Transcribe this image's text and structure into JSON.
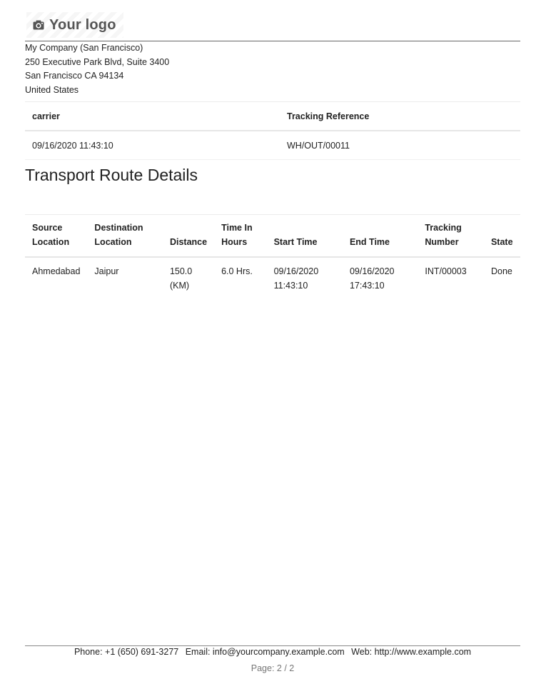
{
  "logo": {
    "text": "Your logo",
    "icon": "camera-icon"
  },
  "company": {
    "name": "My Company (San Francisco)",
    "street": "250 Executive Park Blvd, Suite 3400",
    "city_line": "San Francisco CA 94134",
    "country": "United States"
  },
  "carrier_table": {
    "headers": [
      "carrier",
      "Tracking Reference"
    ],
    "row": [
      "09/16/2020 11:43:10",
      "WH/OUT/00011"
    ]
  },
  "section_title": "Transport Route Details",
  "route_table": {
    "headers": [
      [
        "Source",
        "Location"
      ],
      [
        "Destination",
        "Location"
      ],
      [
        "Distance"
      ],
      [
        "Time In",
        "Hours"
      ],
      [
        "Start Time"
      ],
      [
        "End Time"
      ],
      [
        "Tracking",
        "Number"
      ],
      [
        "State"
      ]
    ],
    "rows": [
      {
        "source": "Ahmedabad",
        "destination": "Jaipur",
        "distance": [
          "150.0",
          "(KM)"
        ],
        "time_hours": "6.0 Hrs.",
        "start_time": [
          "09/16/2020",
          "11:43:10"
        ],
        "end_time": [
          "09/16/2020",
          "17:43:10"
        ],
        "tracking_number": "INT/00003",
        "state": "Done"
      }
    ]
  },
  "footer": {
    "phone": "Phone: +1 (650) 691-3277",
    "email": "Email: info@yourcompany.example.com",
    "web": "Web: http://www.example.com",
    "page": "Page: 2 / 2"
  }
}
